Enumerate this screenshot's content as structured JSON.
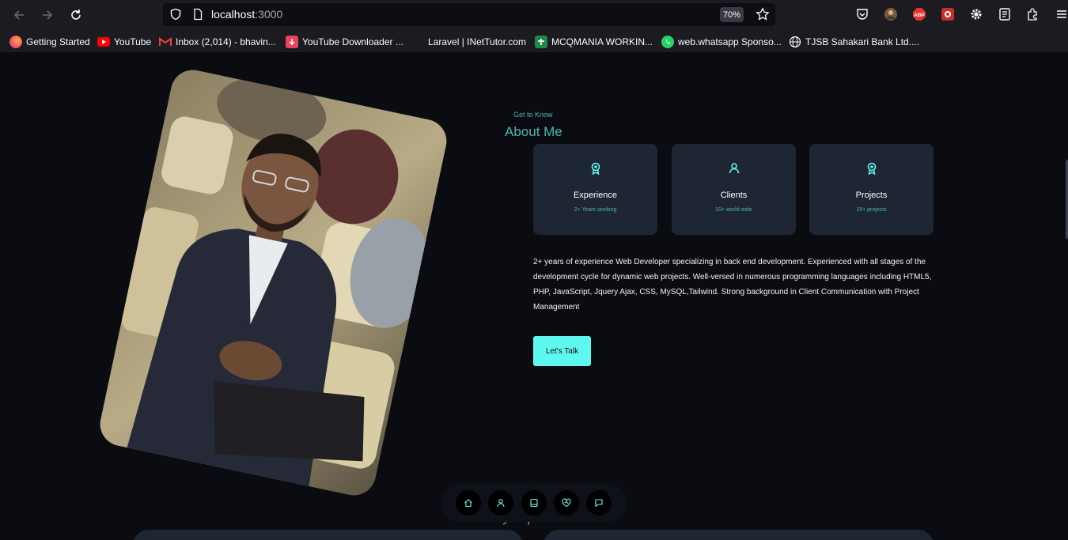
{
  "browser": {
    "url_host": "localhost",
    "url_port": ":3000",
    "zoom": "70%",
    "bookmarks": [
      {
        "label": "Getting Started",
        "icon": "firefox-icon"
      },
      {
        "label": "YouTube",
        "icon": "youtube-icon"
      },
      {
        "label": "Inbox (2,014) - bhavin...",
        "icon": "gmail-icon"
      },
      {
        "label": "YouTube Downloader ...",
        "icon": "download-icon"
      },
      {
        "label": "Laravel | INetTutor.com",
        "icon": "blank-icon"
      },
      {
        "label": "MCQMANIA WORKIN...",
        "icon": "plus-box-icon"
      },
      {
        "label": "web.whatsapp Sponso...",
        "icon": "whatsapp-icon"
      },
      {
        "label": "TJSB Sahakari Bank Ltd....",
        "icon": "globe-icon"
      }
    ],
    "extensions": {
      "abp": "ABP"
    }
  },
  "about": {
    "subtitle": "Get to Know",
    "title": "About Me",
    "cards": [
      {
        "title": "Experience",
        "sub": "2+ Years working",
        "icon": "award-icon"
      },
      {
        "title": "Clients",
        "sub": "10+ world wide",
        "icon": "user-icon"
      },
      {
        "title": "Projects",
        "sub": "15+ projects",
        "icon": "award-icon"
      }
    ],
    "description": "2+ years of experience Web Developer specializing in back end development. Experienced with all stages of the development cycle for dynamic web projects. Well-versed in numerous programming languages including HTML5, PHP, JavaScript, Jquery Ajax, CSS, MySQL,Tailwind. Strong background in Client Communication with Project Management",
    "cta_label": "Let's Talk"
  },
  "next_section": {
    "title": "My Experience"
  },
  "dock": {
    "items": [
      "home-icon",
      "user-icon",
      "book-icon",
      "services-icon",
      "message-icon"
    ]
  },
  "colors": {
    "accent": "#4bb8b0",
    "cta": "#5ff8f0",
    "card": "#1f2633",
    "background": "#0a0c12"
  }
}
